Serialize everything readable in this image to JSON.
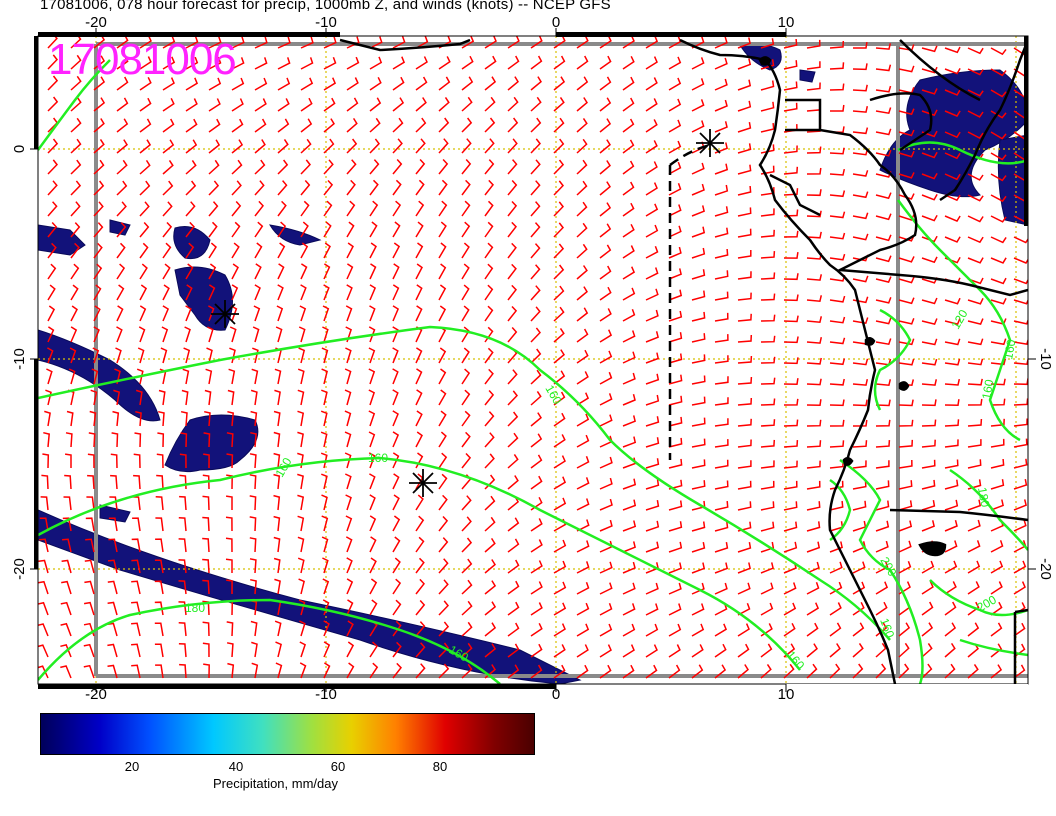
{
  "header": {
    "title": "17081006, 078 hour forecast for precip, 1000mb Z, and winds (knots) -- NCEP GFS"
  },
  "stamp": "17081006",
  "map": {
    "lon_range": [
      -22.5,
      20.5
    ],
    "lat_range": [
      -25.5,
      5
    ],
    "top_lon_ticks": [
      "-20",
      "-10",
      "0",
      "10"
    ],
    "bottom_lon_ticks": [
      "-20",
      "-10",
      "0",
      "10"
    ],
    "left_lat_ticks": [
      "0",
      "-10",
      "-20"
    ],
    "right_lat_ticks": [
      "-10",
      "-20"
    ],
    "contour_labels": [
      "160",
      "160",
      "160",
      "160",
      "160",
      "160",
      "180",
      "160",
      "120",
      "160",
      "180",
      "200",
      "200"
    ],
    "colors": {
      "wind_barbs": "#ff0000",
      "contours": "#22ee22",
      "coast": "#000000",
      "grid": "#d8c000",
      "precip": "#10107a"
    }
  },
  "colorbar": {
    "ticks": [
      "20",
      "40",
      "60",
      "80"
    ],
    "label": "Precipitation, mm/day"
  }
}
